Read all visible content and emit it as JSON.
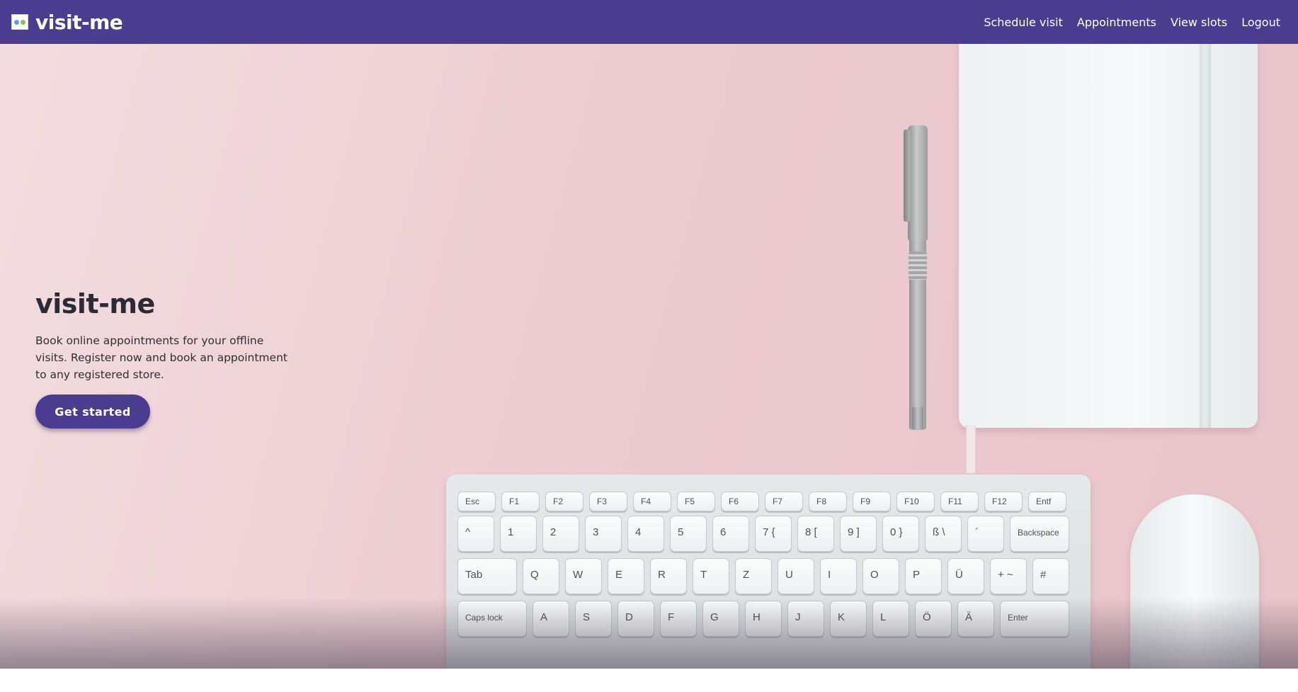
{
  "brand": {
    "name": "visit-me",
    "logo_icon": "visit-me-logo-icon"
  },
  "nav": {
    "links": [
      {
        "label": "Schedule visit"
      },
      {
        "label": "Appointments"
      },
      {
        "label": "View slots"
      },
      {
        "label": "Logout"
      }
    ]
  },
  "hero": {
    "title": "visit-me",
    "description": "Book online appointments for your offline visits. Register now and book an appointment to any registered store.",
    "cta_label": "Get started",
    "scroll_icon": "arrow-down-icon"
  },
  "keyboard": {
    "rows": [
      [
        "Esc",
        "F1",
        "F2",
        "F3",
        "F4",
        "F5",
        "F6",
        "F7",
        "F8",
        "F9",
        "F10",
        "F11",
        "F12",
        "Entf"
      ],
      [
        "^",
        "1",
        "2",
        "3",
        "4",
        "5",
        "6",
        "7 {",
        "8 [",
        "9 ]",
        "0 }",
        "ß \\",
        "´",
        "Backspace"
      ],
      [
        "Tab",
        "Q",
        "W",
        "E",
        "R",
        "T",
        "Z",
        "U",
        "I",
        "O",
        "P",
        "Ü",
        "+ ~",
        "#"
      ],
      [
        "Caps lock",
        "A",
        "S",
        "D",
        "F",
        "G",
        "H",
        "J",
        "K",
        "L",
        "Ö",
        "Ä",
        "Enter"
      ]
    ]
  },
  "colors": {
    "primary": "#4a3d8f",
    "hero_bg": "#ecccd1",
    "text_dark": "#2b2b35"
  }
}
